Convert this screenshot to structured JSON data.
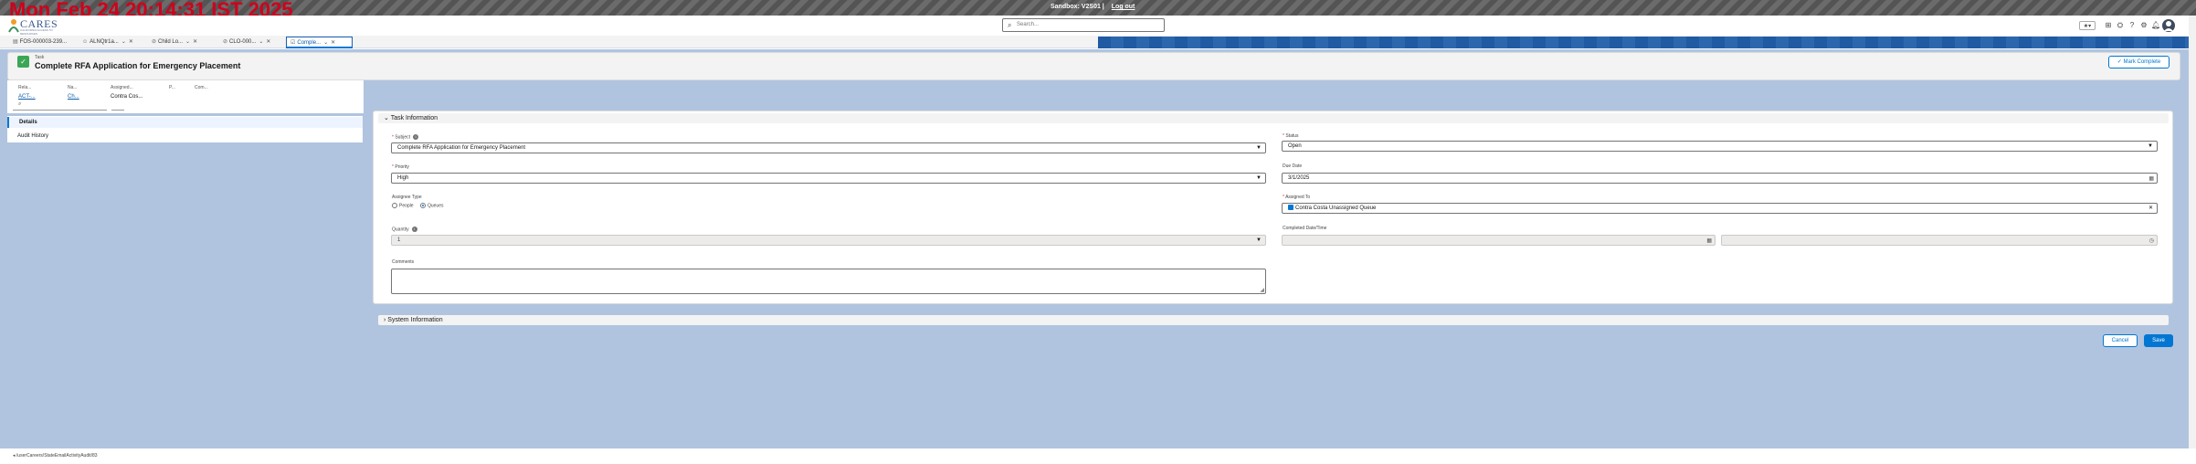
{
  "overlay": {
    "clock": "Mon Feb 24 20:14:31 IST 2025"
  },
  "system_bar": {
    "sandbox": "Sandbox: V2S01 |",
    "logout": "Log out"
  },
  "header": {
    "logo": "CARES",
    "logo_sub": "CALIFORNIA ACCESS TO RESOURCES",
    "search_placeholder": "Search...",
    "avatar_initial": "●"
  },
  "tabs": [
    {
      "label": "FOS-000003-239...",
      "icon": "document-icon"
    },
    {
      "label": "ALNQtr1a...",
      "icon": "person-icon"
    },
    {
      "label": "Child Lo...",
      "icon": "chain-icon"
    },
    {
      "label": "CLO-000...",
      "icon": "chain-icon"
    },
    {
      "label": "Comple...",
      "icon": "task-icon",
      "active": true
    }
  ],
  "record": {
    "type": "Task",
    "title": "Complete RFA Application for Emergency Placement",
    "mark_complete": "Mark Complete"
  },
  "highlights": {
    "labels": [
      "Rela...",
      "Na...",
      "Assigned...",
      "P...",
      "Com..."
    ],
    "values": [
      "ACT-...",
      "Ch...",
      "Contra Cos..."
    ]
  },
  "left_nav": {
    "details": "Details",
    "audit_history": "Audit History"
  },
  "task_info": {
    "section_title": "Task Information",
    "subject_label": "Subject",
    "subject_value": "Complete RFA Application for Emergency Placement",
    "priority_label": "Priority",
    "priority_value": "High",
    "assignee_type_label": "Assignee Type",
    "assignee_type_options": [
      "People",
      "Queues"
    ],
    "assignee_type_selected": "Queues",
    "quantity_label": "Quantity",
    "quantity_value": "1",
    "comments_label": "Comments",
    "status_label": "Status",
    "status_value": "Open",
    "due_date_label": "Due Date",
    "due_date_value": "3/1/2025",
    "assigned_to_label": "Assigned To",
    "assigned_to_value": "Contra Costa Unassigned Queue",
    "completed_label": "Completed Date/Time"
  },
  "system_info": {
    "section_title": "System Information"
  },
  "actions": {
    "cancel": "Cancel",
    "save": "Save"
  },
  "status_bar": {
    "url": "/userCareers/StateEmailActivityAudit/83"
  }
}
